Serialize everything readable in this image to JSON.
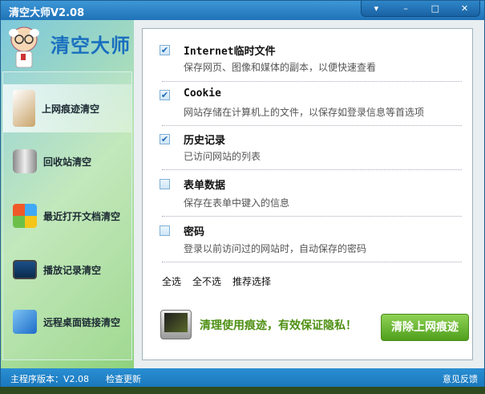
{
  "window": {
    "title": "清空大师V2.08",
    "controls": [
      "▾",
      "–",
      "□",
      "✕"
    ]
  },
  "sidebar": {
    "logo_text": "清空大师",
    "items": [
      {
        "label": "上网痕迹清空",
        "icon": "broom-icon",
        "selected": true
      },
      {
        "label": "回收站清空",
        "icon": "recycle-bin-icon",
        "selected": false
      },
      {
        "label": "最近打开文档清空",
        "icon": "windows-logo-icon",
        "selected": false
      },
      {
        "label": "播放记录清空",
        "icon": "monitor-icon",
        "selected": false
      },
      {
        "label": "远程桌面链接清空",
        "icon": "cubes-icon",
        "selected": false
      }
    ]
  },
  "options": [
    {
      "title": "Internet临时文件",
      "desc": "保存网页、图像和媒体的副本，以便快速查看",
      "checked": true
    },
    {
      "title": "Cookie",
      "desc": "网站存储在计算机上的文件，以保存如登录信息等首选项",
      "checked": true
    },
    {
      "title": "历史记录",
      "desc": "已访问网站的列表",
      "checked": true
    },
    {
      "title": "表单数据",
      "desc": "保存在表单中键入的信息",
      "checked": false
    },
    {
      "title": "密码",
      "desc": "登录以前访问过的网站时，自动保存的密码",
      "checked": false
    }
  ],
  "selection": {
    "all": "全选",
    "none": "全不选",
    "recommended": "推荐选择"
  },
  "action": {
    "slogan": "清理使用痕迹，有效保证隐私！",
    "button": "清除上网痕迹"
  },
  "status": {
    "version": "主程序版本：V2.08",
    "check_update": "检查更新",
    "feedback": "意见反馈"
  },
  "colors": {
    "title_blue": "#1f72b7",
    "accent_green": "#4d8f12",
    "check": "#1d6ab8"
  }
}
